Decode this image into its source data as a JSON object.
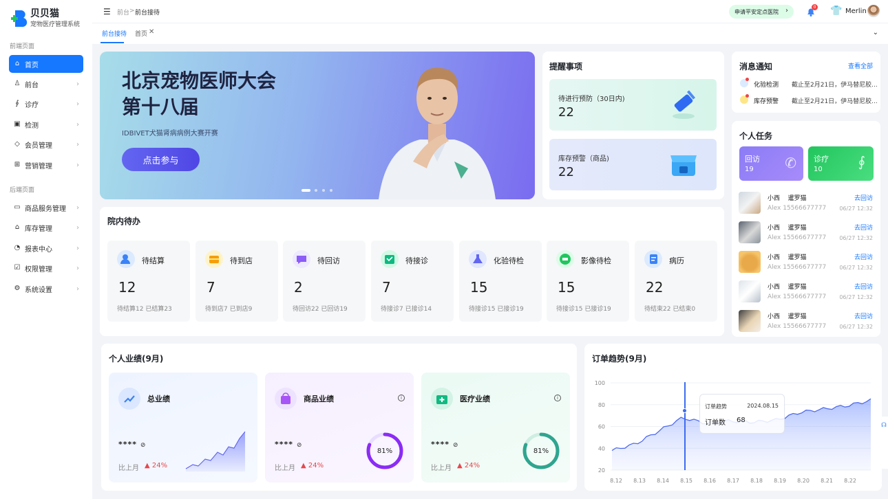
{
  "app": {
    "name": "贝贝猫",
    "subtitle": "宠物医疗管理系统"
  },
  "sidebar": {
    "front_label": "前端页面",
    "back_label": "后端页面",
    "front_items": [
      {
        "label": "首页",
        "icon": "home-icon"
      },
      {
        "label": "前台",
        "icon": "reception-icon"
      },
      {
        "label": "诊疗",
        "icon": "stethoscope-icon"
      },
      {
        "label": "检测",
        "icon": "clipboard-icon"
      },
      {
        "label": "会员管理",
        "icon": "diamond-icon"
      },
      {
        "label": "营销管理",
        "icon": "gift-icon"
      }
    ],
    "back_items": [
      {
        "label": "商品服务管理",
        "icon": "box-icon"
      },
      {
        "label": "库存管理",
        "icon": "warehouse-icon"
      },
      {
        "label": "报表中心",
        "icon": "report-icon"
      },
      {
        "label": "权限管理",
        "icon": "permission-icon"
      },
      {
        "label": "系统设置",
        "icon": "settings-icon"
      }
    ]
  },
  "header": {
    "breadcrumb_parent": "前台",
    "breadcrumb_sep": ">",
    "breadcrumb_current": "前台接待",
    "apply_button": "申请平安定点医院",
    "notification_count": "0",
    "user_name": "Merlin"
  },
  "tabs": [
    {
      "label": "前台接待"
    },
    {
      "label": "首页"
    }
  ],
  "banner": {
    "title_line1": "北京宠物医师大会",
    "title_line2": "第十八届",
    "subtitle": "IDBIVET犬猫肾病病例大赛开赛",
    "button": "点击参与"
  },
  "reminders": {
    "title": "提醒事项",
    "items": [
      {
        "label": "待进行预防（30日内)",
        "value": "22"
      },
      {
        "label": "库存预警（商品)",
        "value": "22"
      }
    ]
  },
  "messages": {
    "title": "消息通知",
    "view_all": "查看全部",
    "items": [
      {
        "tag": "化验检测",
        "text": "截止至2月21日，伊马替尼胶..."
      },
      {
        "tag": "库存预警",
        "text": "截止至2月21日，伊马替尼胶..."
      }
    ]
  },
  "tasks": {
    "title": "个人任务",
    "tiles": [
      {
        "label": "回访",
        "count": "19"
      },
      {
        "label": "诊疗",
        "count": "10"
      }
    ],
    "rows": [
      {
        "name": "小西",
        "breed": "暹罗猫",
        "phone": "Alex 15566677777",
        "action": "去回访",
        "time": "06/27 12:32"
      },
      {
        "name": "小西",
        "breed": "暹罗猫",
        "phone": "Alex 15566677777",
        "action": "去回访",
        "time": "06/27 12:32"
      },
      {
        "name": "小西",
        "breed": "暹罗猫",
        "phone": "Alex 15566677777",
        "action": "去回访",
        "time": "06/27 12:32"
      },
      {
        "name": "小西",
        "breed": "暹罗猫",
        "phone": "Alex 15566677777",
        "action": "去回访",
        "time": "06/27 12:32"
      },
      {
        "name": "小西",
        "breed": "暹罗猫",
        "phone": "Alex 15566677777",
        "action": "去回访",
        "time": "06/27 12:32"
      }
    ]
  },
  "todos": {
    "title": "院内待办",
    "items": [
      {
        "label": "待结算",
        "value": "12",
        "sub": "待结算12  已结算23",
        "color": "#3b82f6"
      },
      {
        "label": "待到店",
        "value": "7",
        "sub": "待到店7  已到店9",
        "color": "#f59e0b"
      },
      {
        "label": "待回访",
        "value": "2",
        "sub": "待回访22  已回访19",
        "color": "#8b5cf6"
      },
      {
        "label": "待接诊",
        "value": "7",
        "sub": "待接诊7  已接诊14",
        "color": "#10b981"
      },
      {
        "label": "化验待检",
        "value": "15",
        "sub": "待接诊15  已接诊19",
        "color": "#6366f1"
      },
      {
        "label": "影像待检",
        "value": "15",
        "sub": "待接诊15  已接诊19",
        "color": "#22c55e"
      },
      {
        "label": "病历",
        "value": "22",
        "sub": "待结束22  已结束0",
        "color": "#3b82f6"
      }
    ]
  },
  "performance": {
    "title": "个人业绩(9月)",
    "cards": [
      {
        "title": "总业绩",
        "mask": "****",
        "compare": "比上月",
        "pct": "24%"
      },
      {
        "title": "商品业绩",
        "mask": "****",
        "compare": "比上月",
        "pct": "24%",
        "ring": "81%",
        "ring_value": 81
      },
      {
        "title": "医疗业绩",
        "mask": "****",
        "compare": "比上月",
        "pct": "24%",
        "ring": "81%",
        "ring_value": 81
      }
    ]
  },
  "orders": {
    "title": "订单趋势(9月)",
    "tooltip": {
      "series": "订单趋势",
      "date": "2024.08.15",
      "label": "订单数",
      "value": "68"
    }
  },
  "chart_data": {
    "type": "area",
    "x": [
      "8.12",
      "8.13",
      "8.14",
      "8.15",
      "8.16",
      "8.17",
      "8.18",
      "8.19",
      "8.20",
      "8.21",
      "8.22"
    ],
    "y_ticks": [
      "100",
      "80",
      "60",
      "40",
      "20"
    ],
    "ylim": [
      20,
      100
    ],
    "values": [
      38,
      44,
      56,
      68,
      63,
      65,
      64,
      66,
      73,
      76,
      79,
      84
    ]
  },
  "colors": {
    "primary": "#1677ff",
    "danger": "#e5484d",
    "purple": "#7c3aed",
    "teal": "#2fa58f"
  }
}
